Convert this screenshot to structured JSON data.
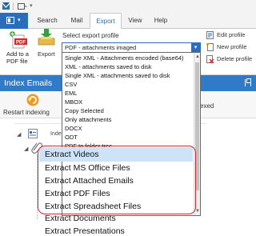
{
  "ribbon_tabs": [
    "Search",
    "Mail",
    "Export",
    "View",
    "Help"
  ],
  "active_tab": "Export",
  "ribbon": {
    "add_pdf_label": "Add to a PDF file",
    "export_label": "Export",
    "select_profile_label": "Select export profile",
    "selected_profile": "PDF - attachments imaged",
    "edit_profile": "Edit profile",
    "new_profile": "New profile",
    "delete_profile": "Delete profile"
  },
  "band_title": "Index Emails",
  "toolbar": {
    "restart_label": "Restart indexing",
    "partial_label": "exed"
  },
  "tree": {
    "partial_label": "Inde"
  },
  "dropdown_items": [
    "Single XML - Attachments encoded (base64)",
    "XML - attachments saved to disk",
    "Single XML - attachments saved to disk",
    "CSV",
    "EML",
    "MBOX",
    "Copy Selected",
    "Only attachments",
    "DOCX",
    "ODT",
    "PDF to folder tree"
  ],
  "extract_items": [
    "Extract Videos",
    "Extract MS Office Files",
    "Extract Attached Emails",
    "Extract PDF Files",
    "Extract Spreadsheet Files",
    "Extract Documents",
    "Extract Presentations"
  ],
  "colors": {
    "accent": "#2a6ebb",
    "band": "#2f7bc9",
    "highlight": "#cfe3f8",
    "red_outline": "#d8242a"
  }
}
